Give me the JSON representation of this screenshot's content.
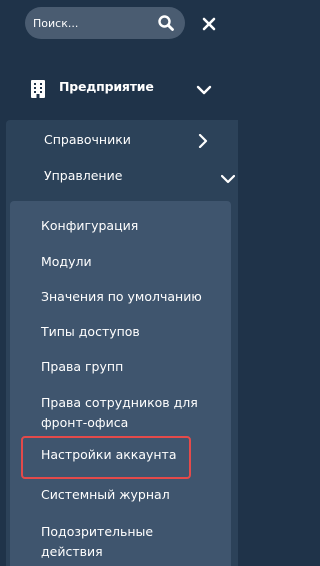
{
  "search": {
    "placeholder": "Поиск..."
  },
  "icons": {
    "search": "search-icon",
    "close": "close-icon",
    "building": "building-icon",
    "chevron_down": "chevron-down-icon",
    "chevron_right": "chevron-right-icon"
  },
  "menu": {
    "enterprise": {
      "label": "Предприятие"
    },
    "level1": [
      {
        "label": "Справочники"
      },
      {
        "label": "Управление"
      }
    ],
    "management_items": [
      {
        "label": "Конфигурация"
      },
      {
        "label": "Модули"
      },
      {
        "label": "Значения по умолчанию"
      },
      {
        "label": "Типы доступов"
      },
      {
        "label": "Права групп"
      },
      {
        "label": "Права сотрудников для\nфронт-офиса"
      },
      {
        "label": "Настройки аккаунта"
      },
      {
        "label": "Системный журнал"
      },
      {
        "label": "Подозрительные\nдействия"
      }
    ]
  },
  "colors": {
    "sidebar_bg": "#1f3349",
    "level1_bg": "#2c4259",
    "level2_bg": "#3f556e",
    "search_bg": "#4a5c71",
    "highlight": "#e44a4a"
  }
}
